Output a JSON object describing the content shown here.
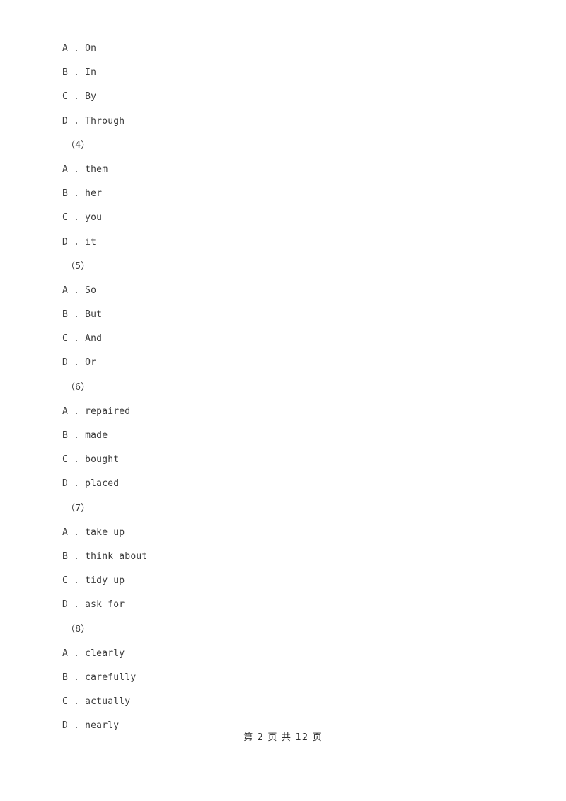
{
  "document": {
    "page_label": "第 2 页 共 12 页",
    "page_number": "2",
    "total_pages": "12",
    "text_color": "#3b3b3b",
    "background_color": "#ffffff"
  },
  "blocks": [
    {
      "group_label": "（4）",
      "options": [
        {
          "letter": "A",
          "separator": " . ",
          "text": "On"
        },
        {
          "letter": "B",
          "separator": " . ",
          "text": "In"
        },
        {
          "letter": "C",
          "separator": " . ",
          "text": "By"
        },
        {
          "letter": "D",
          "separator": " . ",
          "text": "Through"
        }
      ]
    },
    {
      "group_label": "（5）",
      "options": [
        {
          "letter": "A",
          "separator": " . ",
          "text": "them"
        },
        {
          "letter": "B",
          "separator": " . ",
          "text": "her"
        },
        {
          "letter": "C",
          "separator": " . ",
          "text": "you"
        },
        {
          "letter": "D",
          "separator": " . ",
          "text": "it"
        }
      ]
    },
    {
      "group_label": "（6）",
      "options": [
        {
          "letter": "A",
          "separator": " . ",
          "text": "So"
        },
        {
          "letter": "B",
          "separator": " . ",
          "text": "But"
        },
        {
          "letter": "C",
          "separator": " . ",
          "text": "And"
        },
        {
          "letter": "D",
          "separator": " . ",
          "text": "Or"
        }
      ]
    },
    {
      "group_label": "（7）",
      "options": [
        {
          "letter": "A",
          "separator": " . ",
          "text": "repaired"
        },
        {
          "letter": "B",
          "separator": " . ",
          "text": "made"
        },
        {
          "letter": "C",
          "separator": " . ",
          "text": "bought"
        },
        {
          "letter": "D",
          "separator": " . ",
          "text": "placed"
        }
      ]
    },
    {
      "group_label": "（8）",
      "options": [
        {
          "letter": "A",
          "separator": " . ",
          "text": "take up"
        },
        {
          "letter": "B",
          "separator": " . ",
          "text": "think about"
        },
        {
          "letter": "C",
          "separator": " . ",
          "text": "tidy up"
        },
        {
          "letter": "D",
          "separator": " . ",
          "text": "ask for"
        }
      ]
    },
    {
      "group_label": null,
      "options": [
        {
          "letter": "A",
          "separator": " . ",
          "text": "clearly"
        },
        {
          "letter": "B",
          "separator": " . ",
          "text": "carefully"
        },
        {
          "letter": "C",
          "separator": " . ",
          "text": "actually"
        },
        {
          "letter": "D",
          "separator": " . ",
          "text": "nearly"
        }
      ]
    }
  ]
}
